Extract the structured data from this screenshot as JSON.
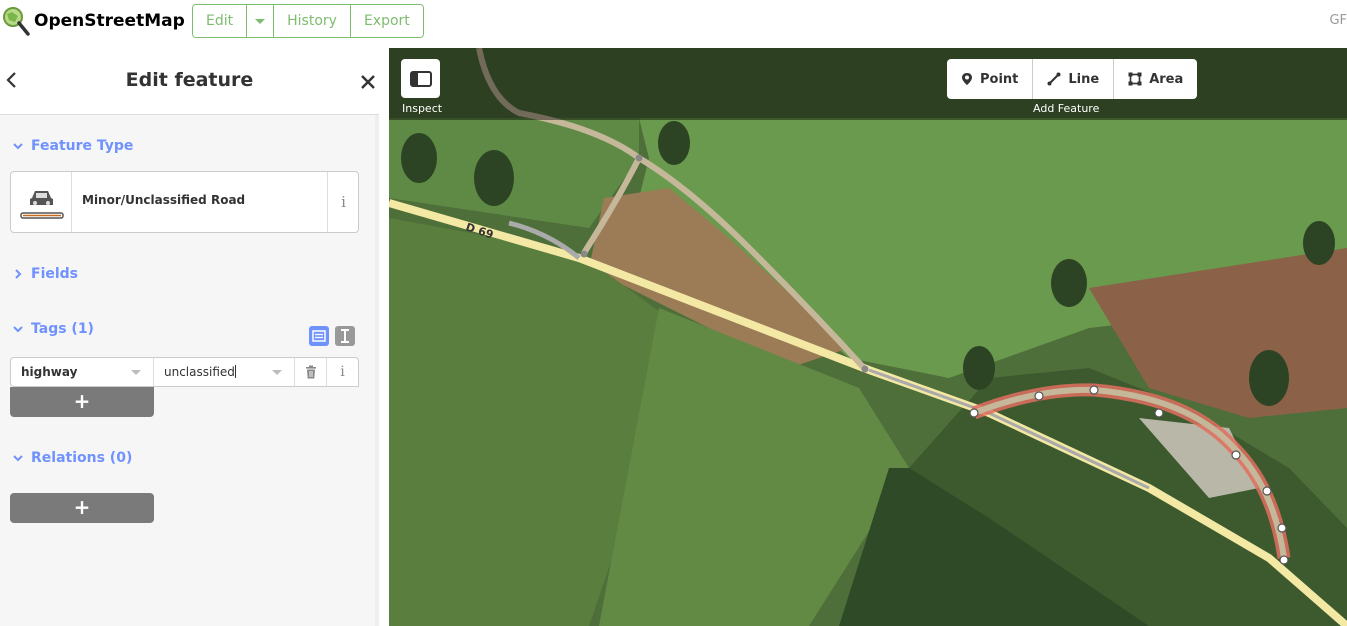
{
  "header": {
    "brand": "OpenStreetMap",
    "edit_label": "Edit",
    "history_label": "History",
    "export_label": "Export",
    "right_text": "GF"
  },
  "sidebar": {
    "title": "Edit feature",
    "feature_type": {
      "section_label": "Feature Type",
      "preset_name": "Minor/Unclassified Road",
      "info_glyph": "i"
    },
    "fields": {
      "section_label": "Fields"
    },
    "tags": {
      "section_label": "Tags (1)",
      "rows": [
        {
          "key": "highway",
          "value": "unclassified",
          "info_glyph": "i"
        }
      ],
      "add_label": "+"
    },
    "relations": {
      "section_label": "Relations (0)",
      "add_label": "+"
    }
  },
  "map": {
    "inspect_label": "Inspect",
    "tools": [
      {
        "label": "Point",
        "icon": "point-icon"
      },
      {
        "label": "Line",
        "icon": "line-icon"
      },
      {
        "label": "Area",
        "icon": "area-icon"
      }
    ],
    "add_feature_label": "Add Feature",
    "road_ref_label": "D 69"
  },
  "colors": {
    "brand_green": "#7ebc6f",
    "section_blue": "#7092ff",
    "selected_way": "#e06e5f",
    "main_road": "#f3e8a4",
    "track_road": "#c5b89a"
  }
}
